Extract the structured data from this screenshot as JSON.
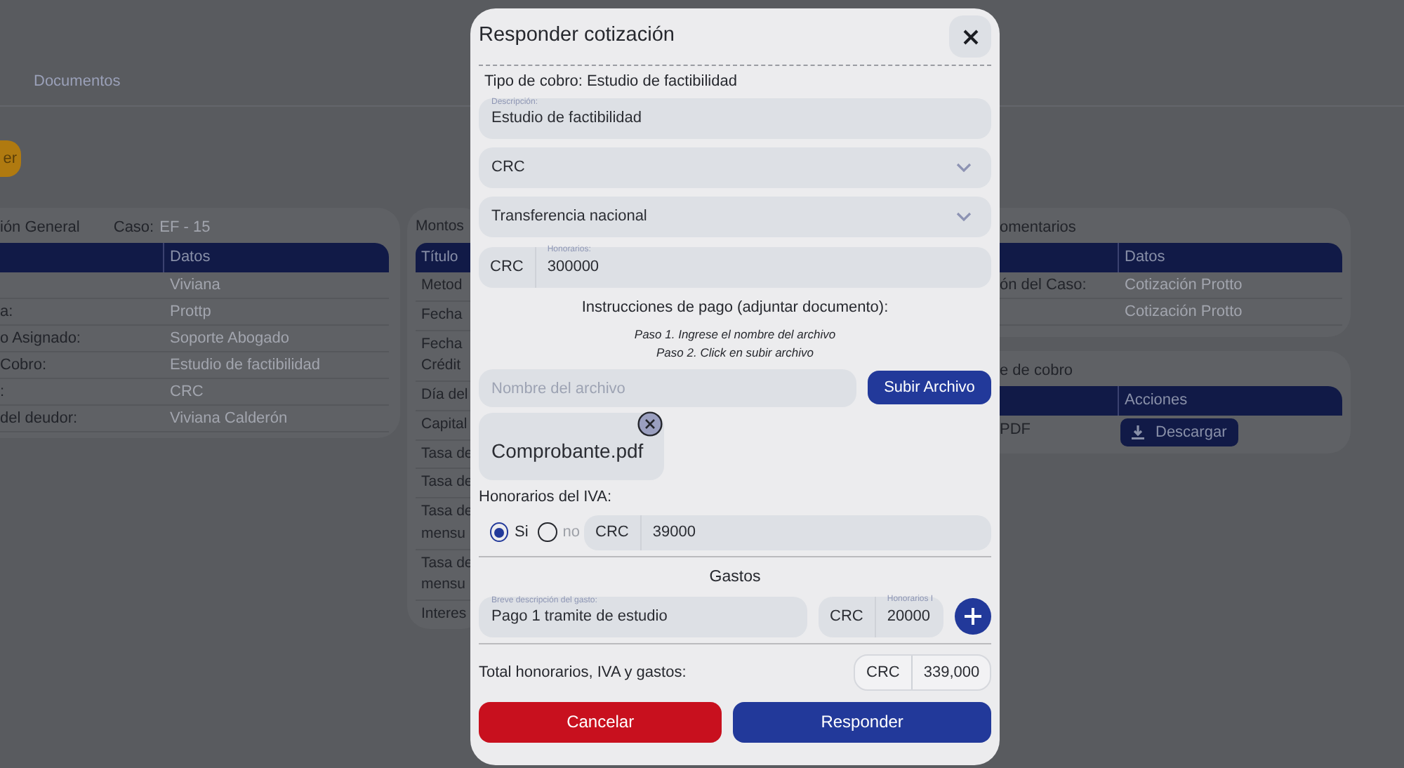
{
  "background": {
    "tabs": [
      {
        "label": "Documentos"
      }
    ],
    "action_button": "er",
    "general_card": {
      "title": "ión General",
      "case_label": "Caso:",
      "case_value": "EF - 15",
      "header": "Datos",
      "rows": [
        {
          "value": "Viviana"
        },
        {
          "label": "a:",
          "value": "Prottp"
        },
        {
          "label": "o Asignado:",
          "value": "Soporte Abogado"
        },
        {
          "label": "Cobro:",
          "value": "Estudio de factibilidad"
        },
        {
          "label": ":",
          "value": "CRC"
        },
        {
          "label": "del deudor:",
          "value": "Viviana Calderón"
        }
      ]
    },
    "amounts_card": {
      "title": "Montos",
      "header": "Título",
      "rows": [
        {
          "lines": [
            "Metod"
          ]
        },
        {
          "lines": [
            "Fecha"
          ]
        },
        {
          "lines": [
            "Fecha",
            "Crédit"
          ]
        },
        {
          "lines": [
            "Día del"
          ]
        },
        {
          "lines": [
            "Capital"
          ]
        },
        {
          "lines": [
            "Tasa de"
          ]
        },
        {
          "lines": [
            "Tasa de"
          ]
        },
        {
          "lines": [
            "Tasa de",
            "mensu"
          ]
        },
        {
          "lines": [
            "Tasa de",
            "mensu"
          ]
        },
        {
          "lines": [
            "Interes"
          ]
        }
      ]
    },
    "comments_card": {
      "title": "omentarios",
      "header": "Datos",
      "rows": [
        {
          "label": "ón del Caso:",
          "value": "Cotización Protto"
        },
        {
          "value": "Cotización Protto"
        }
      ]
    },
    "billing_card": {
      "title": "e de cobro",
      "header": "Acciones",
      "rows": [
        {
          "label": "PDF",
          "action": "Descargar"
        }
      ]
    }
  },
  "modal": {
    "title": "Responder cotización",
    "billing_type": "Tipo de cobro: Estudio de factibilidad",
    "description": {
      "label": "Descripción:",
      "value": "Estudio de factibilidad"
    },
    "currency_select": {
      "value": "CRC"
    },
    "method_select": {
      "value": "Transferencia nacional"
    },
    "fees": {
      "prefix": "CRC",
      "label": "Honorarios:",
      "value": "300000"
    },
    "instructions": "Instrucciones de pago (adjuntar documento):",
    "steps": [
      "Paso 1. Ingrese el nombre del archivo",
      "Paso 2. Click en subir archivo"
    ],
    "file_name": {
      "placeholder": "Nombre del archivo"
    },
    "upload_button": "Subir Archivo",
    "attachment": "Comprobante.pdf",
    "iva": {
      "label": "Honorarios del IVA:",
      "options": [
        {
          "label": "Si",
          "selected": true
        },
        {
          "label": "no",
          "selected": false
        }
      ],
      "prefix": "CRC",
      "value": "39000"
    },
    "expenses": {
      "title": "Gastos",
      "description_label": "Breve descripción del gasto:",
      "description": "Pago 1 tramite de estudio",
      "prefix": "CRC",
      "amount_label": "Honorarios I",
      "amount": "20000"
    },
    "total": {
      "label": "Total honorarios, IVA y gastos:",
      "prefix": "CRC",
      "value": "339,000"
    },
    "buttons": [
      {
        "label": "Cancelar",
        "kind": "cancel"
      },
      {
        "label": "Responder",
        "kind": "primary"
      }
    ]
  }
}
